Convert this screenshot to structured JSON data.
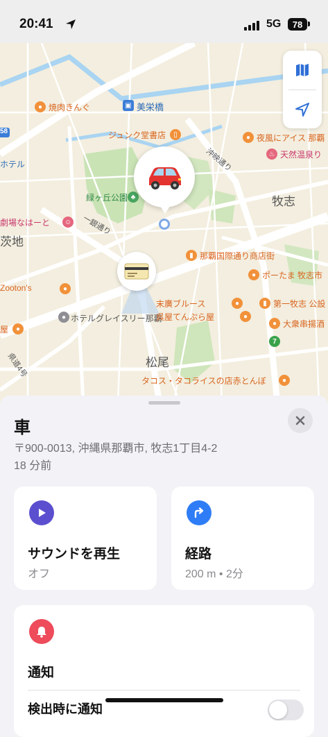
{
  "status_bar": {
    "time": "20:41",
    "network": "5G",
    "battery": "78"
  },
  "map": {
    "labels": {
      "yakiniku": "焼肉きんぐ",
      "miebashi": "美栄橋",
      "junkudo": "ジュンク堂書店",
      "yokaze": "夜風にアイス 那覇",
      "tenzen": "天然温泉り",
      "hotel_left": "ホテル",
      "midorigaoka": "緑ヶ丘公園",
      "makishi": "牧志",
      "gekijo": "劇場なはーと",
      "chi": "茨地",
      "kokusai": "那覇国際通り商店街",
      "potama": "ポーたま 牧志市",
      "zootons": "Zooton's",
      "suehiro": "末廣ブルース",
      "daiichi": "第一牧志 公設",
      "hotel_gracery": "ホテルグレイスリー那覇",
      "goten": "呉屋てんぷら屋",
      "taishu": "大衆串揚酒",
      "ya": "屋",
      "matsuo": "松尾",
      "tacos": "タコス・タコライスの店赤とんぼ"
    },
    "roads": {
      "mitsumon": "沖映通り",
      "ichigin": "一銀通り",
      "route58": "58",
      "kendo": "県道4号"
    }
  },
  "sheet": {
    "title": "車",
    "address": "〒900-0013, 沖縄県那覇市, 牧志1丁目4-2",
    "time_ago": "18 分前",
    "cards": {
      "sound": {
        "label": "サウンドを再生",
        "sub": "オフ"
      },
      "directions": {
        "label": "経路",
        "sub": "200 m • 2分"
      }
    },
    "notifications": {
      "label": "通知",
      "partial_row": "検出時に通知"
    }
  },
  "colors": {
    "sound_icon": "#5b4fcf",
    "directions_icon": "#2f7df6",
    "notify_icon": "#ee4b5b",
    "map_controls": "#2f6fd6"
  },
  "icons": [
    "location-arrow-icon",
    "map-icon",
    "navigation-arrow-icon",
    "car-icon",
    "transit-card-icon",
    "close-icon",
    "play-icon",
    "turn-arrow-icon",
    "bell-icon"
  ]
}
